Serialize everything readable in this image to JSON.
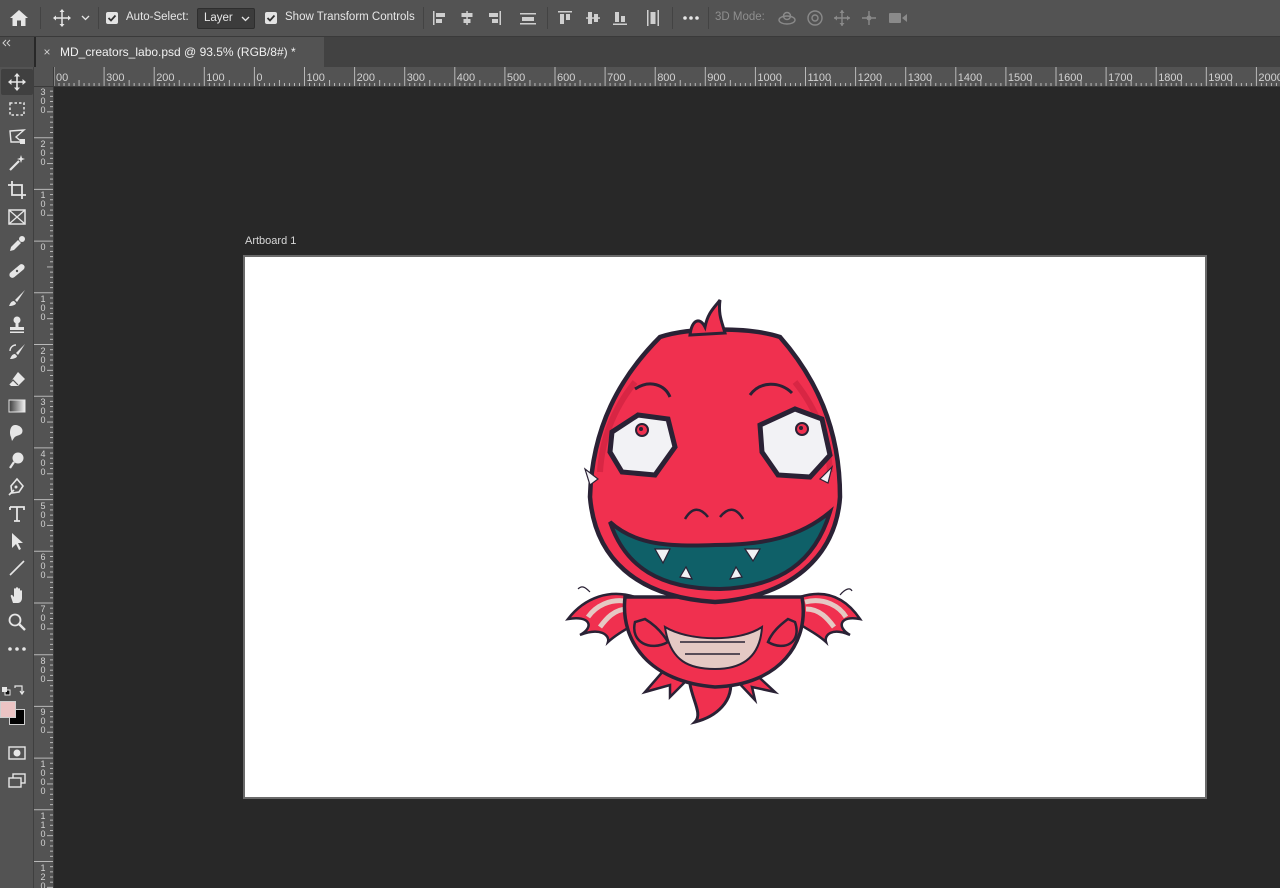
{
  "app": {
    "name": "Adobe Photoshop"
  },
  "options_bar": {
    "auto_select_label": "Auto-Select:",
    "auto_select_checked": true,
    "auto_select_target": "Layer",
    "show_transform_label": "Show Transform Controls",
    "show_transform_checked": true,
    "mode_3d_label": "3D Mode:"
  },
  "document_tab": {
    "close_glyph": "×",
    "title": "MD_creators_labo.psd @ 93.5% (RGB/8#) *"
  },
  "rulers": {
    "horizontal_labels": [
      "00",
      "300",
      "200",
      "100",
      "0",
      "100",
      "200",
      "300",
      "400",
      "500",
      "600",
      "700",
      "800",
      "900",
      "1000",
      "1100",
      "1200",
      "1300",
      "1400",
      "1500",
      "1600",
      "1700",
      "1800",
      "1900",
      "2000"
    ],
    "vertical_labels": [
      "300",
      "200",
      "100",
      "0",
      "100",
      "200",
      "300",
      "400",
      "500",
      "600",
      "700",
      "800",
      "900",
      "1000",
      "1100",
      "1200"
    ]
  },
  "canvas": {
    "artboard_name": "Artboard 1",
    "background_color": "#282828",
    "artboard_color": "#ffffff",
    "illustration": "red baby dragon cartoon"
  },
  "toolbar": {
    "tools": [
      "move-tool",
      "marquee-tool",
      "lasso-tool",
      "magic-wand-tool",
      "crop-tool",
      "frame-tool",
      "eyedropper-tool",
      "healing-brush-tool",
      "brush-tool",
      "clone-stamp-tool",
      "history-brush-tool",
      "eraser-tool",
      "gradient-tool",
      "blur-tool",
      "dodge-tool",
      "pen-tool",
      "type-tool",
      "path-selection-tool",
      "line-tool",
      "hand-tool",
      "zoom-tool",
      "edit-toolbar"
    ],
    "foreground_color": "#ecc4c4",
    "background_color": "#000000"
  },
  "colors": {
    "panel": "#535353",
    "dragon_red": "#f0304f",
    "dragon_outline": "#2a2235",
    "mouth_teal": "#0f6068",
    "belly": "#e5c9c4"
  }
}
